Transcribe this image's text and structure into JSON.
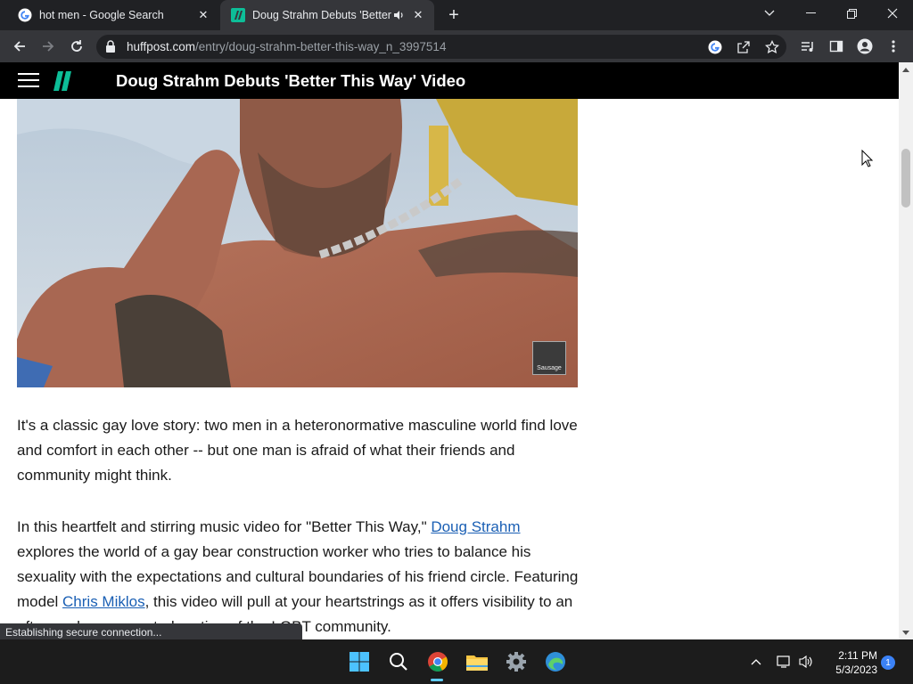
{
  "browser": {
    "tabs": [
      {
        "title": "hot men - Google Search",
        "favicon": "google-g-icon",
        "active": false
      },
      {
        "title": "Doug Strahm Debuts 'Better",
        "favicon": "huffpost-icon",
        "active": true,
        "audio": "speaker-icon"
      }
    ],
    "new_tab_label": "+",
    "address": {
      "host": "huffpost.com",
      "path": "/entry/doug-strahm-better-this-way_n_3997514"
    }
  },
  "site": {
    "header_title": "Doug Strahm Debuts 'Better This Way' Video",
    "hero_watermark": "Sausage"
  },
  "article": {
    "p1": "It's a classic gay love story: two men in a heteronormative masculine world find love and comfort in each other -- but one man is afraid of what their friends and community might think.",
    "p2_a": "In this heartfelt and stirring music video for \"Better This Way,\" ",
    "p2_link1": "Doug Strahm",
    "p2_b": " explores the world of a gay bear construction worker who tries to balance his sexuality with the expectations and cultural boundaries of his friend circle. Featuring model ",
    "p2_link2": "Chris Miklos",
    "p2_c": ", this video will pull at your heartstrings as it offers visibility to an often underrepresented portion of the LGBT community."
  },
  "status_bar": "Establishing secure connection...",
  "taskbar": {
    "time": "2:11 PM",
    "date": "5/3/2023",
    "notification_count": "1"
  },
  "colors": {
    "link": "#1a5fb4",
    "huffpost_green": "#0dbe98",
    "chrome_dark": "#202124"
  }
}
